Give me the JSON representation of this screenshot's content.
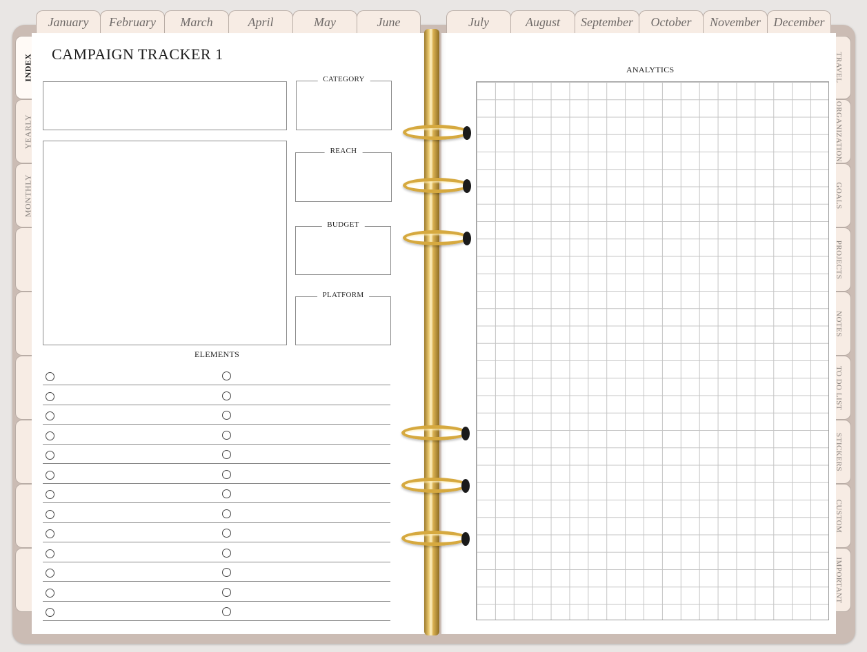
{
  "month_tabs": [
    "January",
    "February",
    "March",
    "April",
    "May",
    "June",
    "July",
    "August",
    "September",
    "October",
    "November",
    "December"
  ],
  "left_tabs": [
    {
      "label": "INDEX",
      "active": true
    },
    {
      "label": "YEARLY",
      "active": false
    },
    {
      "label": "MONTHLY",
      "active": false
    },
    {
      "label": "",
      "active": false
    },
    {
      "label": "",
      "active": false
    },
    {
      "label": "",
      "active": false
    },
    {
      "label": "",
      "active": false
    },
    {
      "label": "",
      "active": false
    },
    {
      "label": "",
      "active": false
    }
  ],
  "right_tabs": [
    "TRAVEL",
    "ORGANIZATION",
    "GOALS",
    "PROJECTS",
    "NOTES",
    "TO DO LIST",
    "STICKERS",
    "CUSTOM",
    "IMPORTANT"
  ],
  "page_title": "CAMPAIGN TRACKER 1",
  "fields": {
    "category": "CATEGORY",
    "reach": "REACH",
    "budget": "BUDGET",
    "platform": "PLATFORM"
  },
  "elements_heading": "ELEMENTS",
  "elements_rows": 13,
  "analytics_heading": "ANALYTICS",
  "colors": {
    "cover": "#cbbcb4",
    "tab": "#f7ece4",
    "rings": "#d6a93f"
  }
}
